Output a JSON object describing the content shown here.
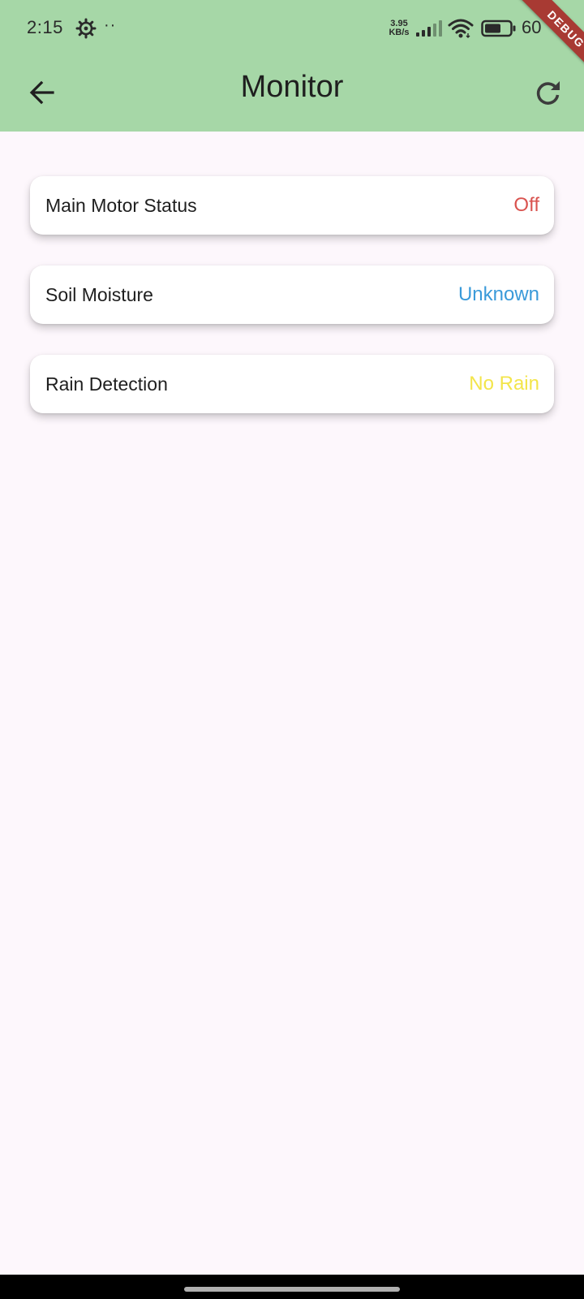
{
  "status_bar": {
    "time": "2:15",
    "dots": "··",
    "speed_value": "3.95",
    "speed_unit": "KB/s",
    "battery_percent": "60"
  },
  "debug_banner": "DEBUG",
  "app_bar": {
    "title": "Monitor",
    "back_icon": "arrow-back-icon",
    "refresh_icon": "refresh-icon"
  },
  "cards": [
    {
      "label": "Main Motor Status",
      "value": "Off",
      "value_color": "#D9534F"
    },
    {
      "label": "Soil Moisture",
      "value": "Unknown",
      "value_color": "#3A9AD9"
    },
    {
      "label": "Rain Detection",
      "value": "No Rain",
      "value_color": "#F3E54A"
    }
  ],
  "colors": {
    "app_bar": "#A6D7A7",
    "background": "#FDF7FC",
    "debug_banner": "#A83A33"
  }
}
